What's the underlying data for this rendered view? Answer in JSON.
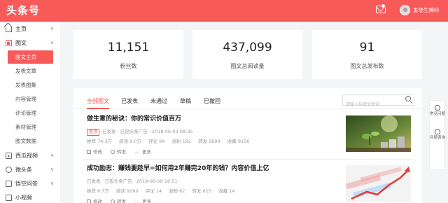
{
  "header": {
    "logo": "头条号",
    "mail_icon": "mail-icon",
    "username": "发现生腾科"
  },
  "sidebar": {
    "items": [
      {
        "label": "主页",
        "icon": "home-icon",
        "caret": "∨"
      },
      {
        "label": "图文",
        "icon": "document-icon",
        "caret": "∧"
      },
      {
        "label": "西瓜视频",
        "icon": "video-icon",
        "caret": "∨"
      },
      {
        "label": "微头条",
        "icon": "micro-headline-icon",
        "caret": "∨"
      },
      {
        "label": "悟空问答",
        "icon": "qa-icon",
        "caret": "∨"
      },
      {
        "label": "小视频",
        "icon": "mini-video-icon",
        "caret": ""
      }
    ],
    "sub_items": [
      "图文主页",
      "发表文章",
      "发表图集",
      "内容管理",
      "评论管理",
      "素材管理",
      "图文数据"
    ],
    "active_sub": "图文主页"
  },
  "stats": [
    {
      "value": "11,151",
      "label": "粉丝数"
    },
    {
      "value": "437,099",
      "label": "图文总阅读量"
    },
    {
      "value": "91",
      "label": "图文总发布数"
    }
  ],
  "tabs": [
    "全部图文",
    "已发表",
    "未通过",
    "草稿",
    "已撤回"
  ],
  "active_tab": "全部图文",
  "search": {
    "placeholder": "请输入标题关键词"
  },
  "articles": [
    {
      "title": "做生意的秘诀：你的常识价值百万",
      "tag": "置顶",
      "meta": "已发表 · 已投头条广告 · 2018-06-03 08:35",
      "stats": [
        "推荐 74.3万",
        "阅读 9.0万",
        "评论 84",
        "涨粉 182",
        "转发 2608",
        "收藏 9156"
      ],
      "actions": [
        "修改",
        "转发",
        "更多"
      ]
    },
    {
      "title": "成功励志：赚钱要趁早=如何用2年赚完20年的钱？内容价值上亿",
      "tag": "",
      "meta": "已发表 · 已投头条广告 · 2018-06-09 18:51",
      "stats": [
        "推荐 6.7万",
        "阅读 9290",
        "评论 14",
        "涨粉 62",
        "转发 615",
        "收藏 14"
      ],
      "actions": [
        "修改",
        "转发",
        "更多"
      ]
    }
  ],
  "float_tools": [
    {
      "label": "常见问题",
      "icon": "help-icon"
    },
    {
      "label": "问题咨询",
      "icon": "headset-icon"
    }
  ],
  "colors": {
    "brand": "#f85959"
  }
}
